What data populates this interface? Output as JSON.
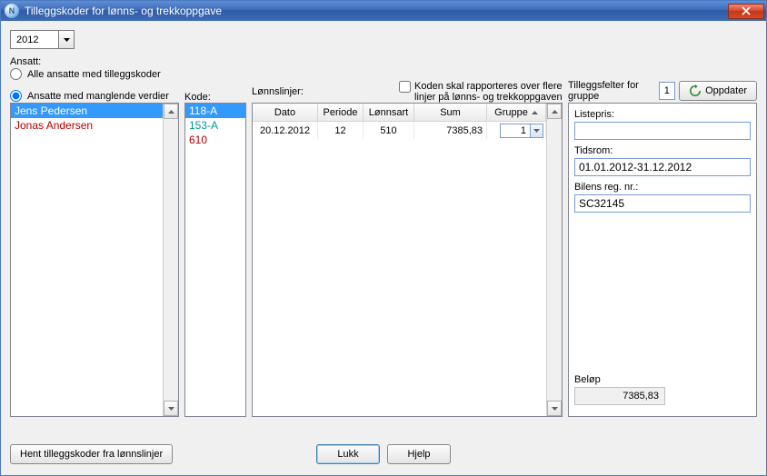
{
  "window": {
    "title": "Tilleggskoder for lønns- og trekkoppgave"
  },
  "year_select": {
    "value": "2012"
  },
  "labels": {
    "ansatt": "Ansatt:",
    "radio_all": "Alle ansatte med tilleggskoder",
    "radio_missing": "Ansatte med manglende verdier",
    "kode": "Kode:",
    "lonnslinjer": "Lønnslinjer:",
    "check_multi": "Koden skal rapporteres over flere linjer på lønns- og trekkoppgaven",
    "tilleggsfelter": "Tilleggsfelter for gruppe",
    "oppdater": "Oppdater",
    "hent": "Hent tilleggskoder fra lønnslinjer",
    "lukk": "Lukk",
    "hjelp": "Hjelp"
  },
  "radio_selected": "missing",
  "employees": [
    {
      "name": "Jens Pedersen",
      "selected": true,
      "style": "normal"
    },
    {
      "name": "Jonas Andersen",
      "selected": false,
      "style": "red"
    }
  ],
  "codes": [
    {
      "code": "118-A",
      "selected": true,
      "style": "normal"
    },
    {
      "code": "153-A",
      "selected": false,
      "style": "teal"
    },
    {
      "code": "610",
      "selected": false,
      "style": "red"
    }
  ],
  "grid": {
    "columns": {
      "dato": "Dato",
      "periode": "Periode",
      "lonnsart": "Lønnsart",
      "sum": "Sum",
      "gruppe": "Gruppe"
    },
    "rows": [
      {
        "dato": "20.12.2012",
        "periode": "12",
        "lonnsart": "510",
        "sum": "7385,83",
        "gruppe": "1"
      }
    ]
  },
  "group_number": "1",
  "fields": {
    "listepris": {
      "label": "Listepris:",
      "value": ""
    },
    "tidsrom": {
      "label": "Tidsrom:",
      "value": "01.01.2012-31.12.2012"
    },
    "regnr": {
      "label": "Bilens reg. nr.:",
      "value": "SC32145"
    },
    "belop": {
      "label": "Beløp",
      "value": "7385,83"
    }
  }
}
